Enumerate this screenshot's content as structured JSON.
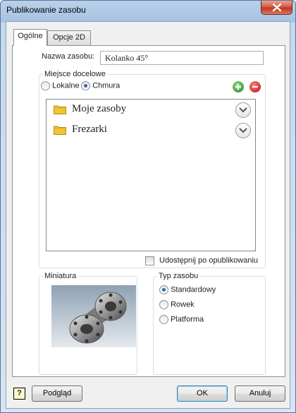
{
  "window": {
    "title": "Publikowanie zasobu"
  },
  "tabs": [
    {
      "label": "Ogólne",
      "active": true
    },
    {
      "label": "Opcje 2D",
      "active": false
    }
  ],
  "general": {
    "name_label": "Nazwa zasobu:",
    "name_value": "Kolanko 45°",
    "destination": {
      "title": "Miejsce docelowe",
      "options": [
        {
          "label": "Lokalne",
          "selected": false
        },
        {
          "label": "Chmura",
          "selected": true
        }
      ],
      "add_icon": "plus-circle-icon",
      "remove_icon": "minus-circle-icon",
      "items": [
        {
          "label": "Moje zasoby",
          "icon": "folder-icon"
        },
        {
          "label": "Frezarki",
          "icon": "folder-icon"
        }
      ],
      "share_label": "Udostępnij po opublikowaniu",
      "share_checked": false
    },
    "thumbnail": {
      "title": "Miniatura"
    },
    "asset_type": {
      "title": "Typ zasobu",
      "options": [
        {
          "label": "Standardowy",
          "selected": true
        },
        {
          "label": "Rowek",
          "selected": false
        },
        {
          "label": "Platforma",
          "selected": false
        }
      ]
    }
  },
  "footer": {
    "help_label": "?",
    "preview_label": "Podgląd",
    "ok_label": "OK",
    "cancel_label": "Anuluj"
  },
  "colors": {
    "add": "#3fa33a",
    "remove": "#d42a2a",
    "folder": "#f2c531",
    "radio_selected": "#2a6ab8"
  }
}
